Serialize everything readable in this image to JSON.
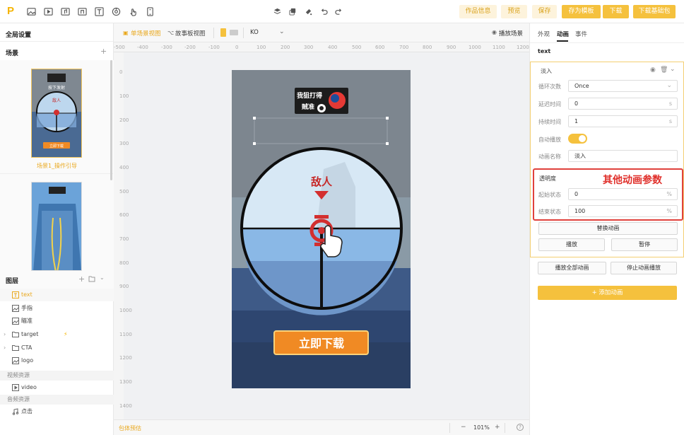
{
  "toolbar": {
    "buttons": {
      "work_info": "作品信息",
      "preview": "预览",
      "save": "保存",
      "save_template": "存为模板",
      "download": "下载",
      "download_base": "下载基础包"
    }
  },
  "left": {
    "global_settings": "全局设置",
    "scenes_title": "场景",
    "scene1_caption": "场景1_操作引导",
    "layers_title": "图层",
    "layers": [
      "text",
      "手指",
      "瞄准",
      "target",
      "CTA",
      "logo"
    ],
    "video_section": "视频资源",
    "video_item": "video",
    "audio_section": "音频资源",
    "audio_item": "点击"
  },
  "canvas": {
    "single_view": "单场景视图",
    "story_view": "故事板视图",
    "lang_value": "KO",
    "play_scene": "播放场景",
    "ruler_h": [
      "-500",
      "-400",
      "-300",
      "-200",
      "-100",
      "0",
      "100",
      "200",
      "300",
      "400",
      "500",
      "600",
      "700",
      "800",
      "900",
      "1000",
      "1100",
      "1200"
    ],
    "ruler_v": [
      "0",
      "100",
      "200",
      "300",
      "400",
      "500",
      "600",
      "700",
      "800",
      "900",
      "1000",
      "1100",
      "1200",
      "1300",
      "1400"
    ],
    "package_estimate": "包体预估",
    "zoom": "101%",
    "zoom_minus": "−",
    "zoom_plus": "+",
    "help": "?",
    "game": {
      "logo_line1": "我狙打得",
      "logo_line2": "贼准",
      "enemy_label": "敌人",
      "cta": "立即下载",
      "thumb_title": "按下发射",
      "thumb_enemy": "敌人",
      "thumb_cta": "立即下载"
    }
  },
  "right": {
    "tabs": [
      "外观",
      "动画",
      "事件"
    ],
    "element_name": "text",
    "anim_title": "淡入",
    "loop_label": "循环次数",
    "loop_value": "Once",
    "delay_label": "延迟时间",
    "delay_value": "0",
    "delay_unit": "s",
    "duration_label": "持续时间",
    "duration_value": "1",
    "duration_unit": "s",
    "autoplay_label": "自动播放",
    "autoplay": true,
    "name_label": "动画名称",
    "name_value": "淡入",
    "opacity_title": "透明度",
    "start_label": "起始状态",
    "start_value": "0",
    "end_label": "结束状态",
    "end_value": "100",
    "percent": "%",
    "annotation": "其他动画参数",
    "replace_btn": "替换动画",
    "play_btn": "播放",
    "pause_btn": "暂停",
    "play_all_btn": "播放全部动画",
    "stop_btn": "停止动画播放",
    "add_btn": "添加动画"
  },
  "colors": {
    "accent": "#f5c13d",
    "annotation_red": "#e0413c",
    "cta_orange": "#f08a24"
  }
}
